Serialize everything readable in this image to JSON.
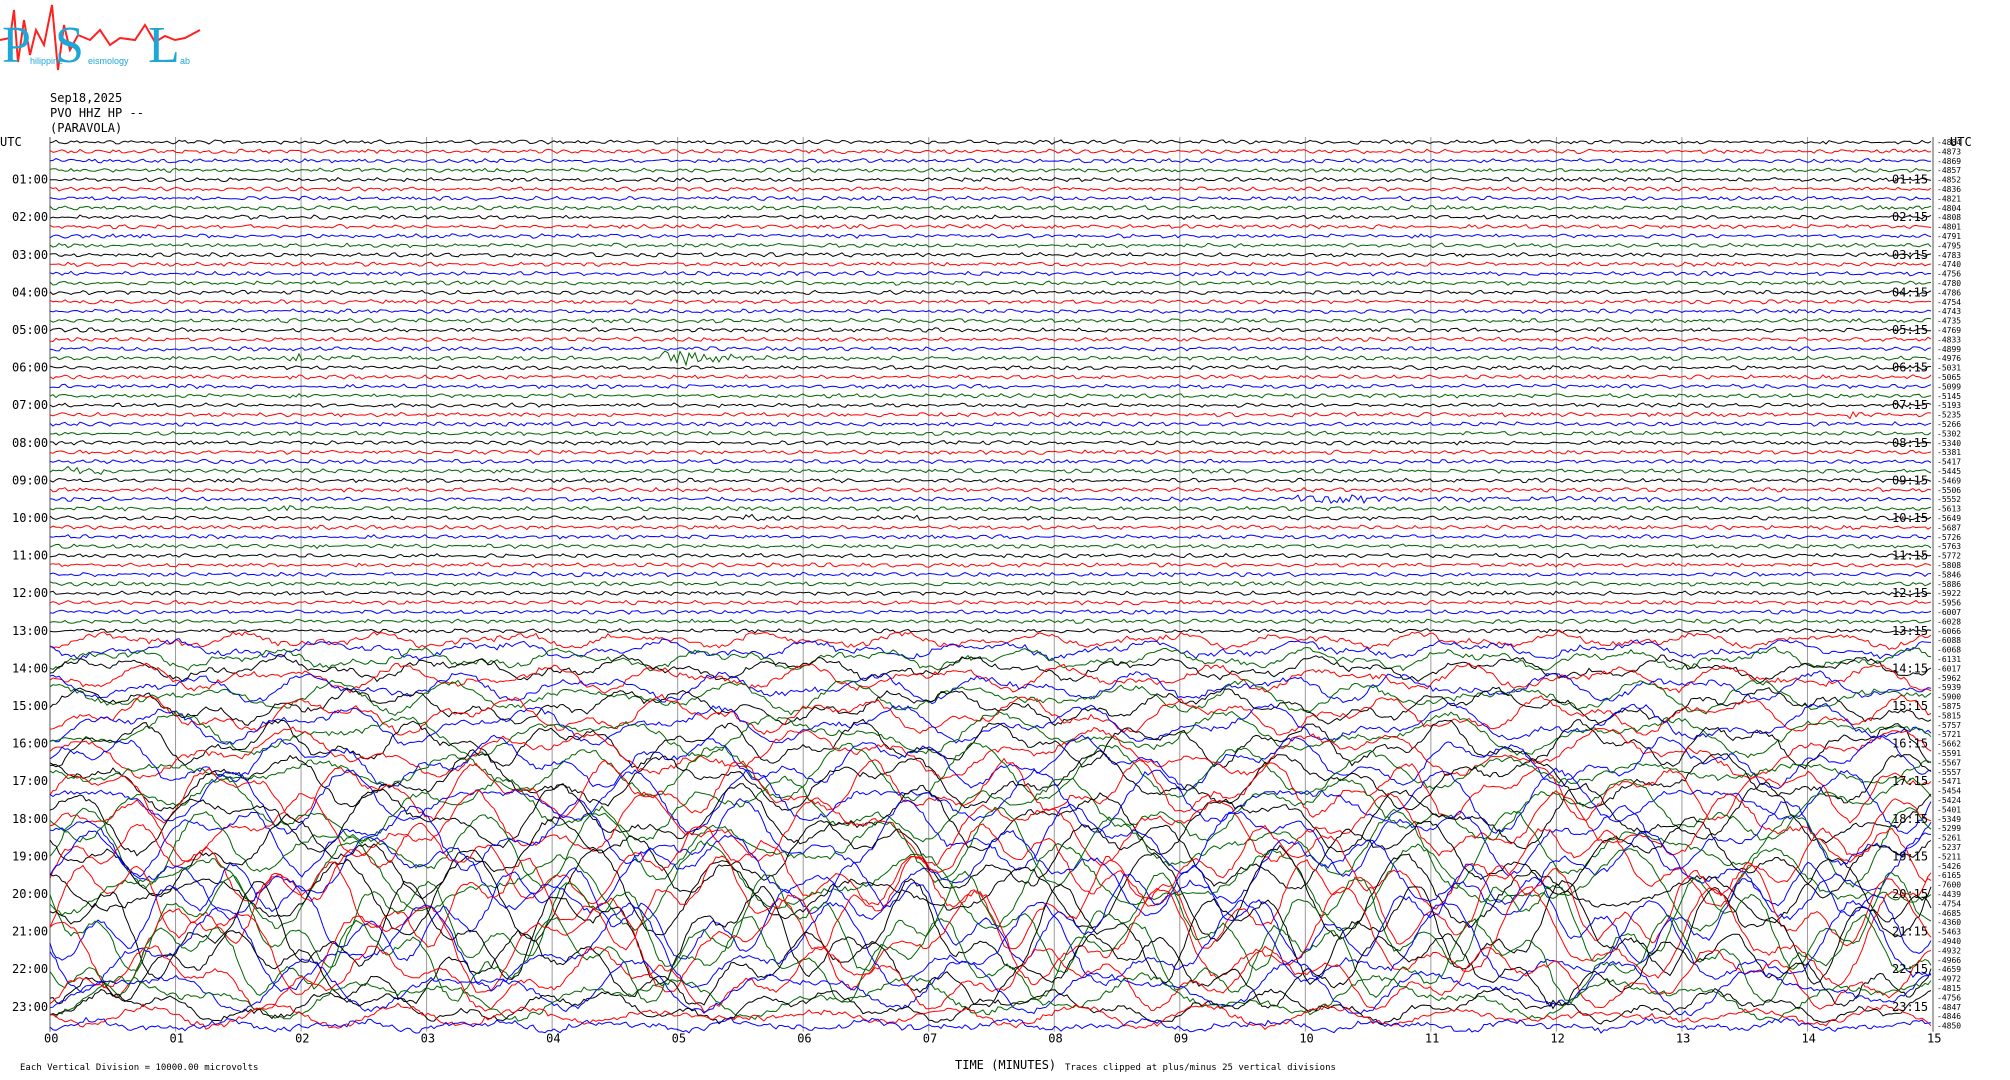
{
  "logo": {
    "letters": [
      "P",
      "S",
      "L"
    ],
    "words": [
      "hilippine",
      "eismology",
      "ab"
    ],
    "colors": {
      "letters": "#1ea7d6",
      "spikes": "#ff2020"
    }
  },
  "header": {
    "date": "Sep18,2025",
    "station": "PVO HHZ HP --",
    "location": "(PARAVOLA)"
  },
  "chart_data": {
    "type": "line",
    "title": "",
    "left_axis_label": "UTC",
    "right_axis_label": "UTC",
    "xlabel": "TIME (MINUTES)",
    "x_ticks": [
      "00",
      "01",
      "02",
      "03",
      "04",
      "05",
      "06",
      "07",
      "08",
      "09",
      "10",
      "11",
      "12",
      "13",
      "14",
      "15"
    ],
    "xlim": [
      0,
      15
    ],
    "left_hour_labels": [
      "01:00",
      "02:00",
      "03:00",
      "04:00",
      "05:00",
      "06:00",
      "07:00",
      "08:00",
      "09:00",
      "10:00",
      "11:00",
      "12:00",
      "13:00",
      "14:00",
      "15:00",
      "16:00",
      "17:00",
      "18:00",
      "19:00",
      "20:00",
      "21:00",
      "22:00",
      "23:00"
    ],
    "right_hour_labels": [
      "01:15",
      "02:15",
      "03:15",
      "04:15",
      "05:15",
      "06:15",
      "07:15",
      "08:15",
      "09:15",
      "10:15",
      "11:15",
      "12:15",
      "13:15",
      "14:15",
      "15:15",
      "16:15",
      "17:15",
      "18:15",
      "19:15",
      "20:15",
      "21:15",
      "22:15",
      "23:15"
    ],
    "trace_colors": [
      "#000000",
      "#ff0000",
      "#0000ff",
      "#006400"
    ],
    "trace_offsets": [
      "-4884",
      "-4873",
      "-4869",
      "-4857",
      "-4852",
      "-4836",
      "-4821",
      "-4804",
      "-4808",
      "-4801",
      "-4791",
      "-4795",
      "-4783",
      "-4740",
      "-4756",
      "-4780",
      "-4786",
      "-4754",
      "-4743",
      "-4735",
      "-4769",
      "-4833",
      "-4899",
      "-4976",
      "-5031",
      "-5065",
      "-5099",
      "-5145",
      "-5193",
      "-5235",
      "-5266",
      "-5302",
      "-5340",
      "-5381",
      "-5417",
      "-5445",
      "-5469",
      "-5506",
      "-5552",
      "-5613",
      "-5649",
      "-5687",
      "-5726",
      "-5763",
      "-5772",
      "-5808",
      "-5846",
      "-5886",
      "-5922",
      "-5956",
      "-6007",
      "-6028",
      "-6066",
      "-6088",
      "-6068",
      "-6131",
      "-6017",
      "-5962",
      "-5939",
      "-5900",
      "-5875",
      "-5815",
      "-5757",
      "-5721",
      "-5662",
      "-5591",
      "-5567",
      "-5557",
      "-5471",
      "-5454",
      "-5424",
      "-5401",
      "-5349",
      "-5299",
      "-5261",
      "-5237",
      "-5211",
      "-5426",
      "-6165",
      "-7600",
      "-4439",
      "-4754",
      "-4685",
      "-4360",
      "-5463",
      "-4940",
      "-4932",
      "-4966",
      "-4659",
      "-4972",
      "-4815",
      "-4756",
      "-4847",
      "-4846",
      "-4850"
    ],
    "events": [
      {
        "trace": 23,
        "start_min": 1.85,
        "end_min": 3.1,
        "amp": 4
      },
      {
        "trace": 23,
        "start_min": 4.85,
        "end_min": 5.9,
        "amp": 14
      },
      {
        "trace": 35,
        "start_min": 0.1,
        "end_min": 0.9,
        "amp": 6
      },
      {
        "trace": 38,
        "start_min": 9.8,
        "end_min": 15.0,
        "amp": 5
      },
      {
        "trace": 39,
        "start_min": 1.8,
        "end_min": 2.6,
        "amp": 6
      },
      {
        "trace": 40,
        "start_min": 5.5,
        "end_min": 5.9,
        "amp": 5
      },
      {
        "trace": 40,
        "start_min": 6.75,
        "end_min": 7.3,
        "amp": 3
      },
      {
        "trace": 29,
        "start_min": 14.3,
        "end_min": 14.9,
        "amp": 3
      },
      {
        "trace": 88,
        "start_min": 11.9,
        "end_min": 12.3,
        "amp": 8
      }
    ],
    "footer_left": "Each Vertical Division = 10000.00 microvolts",
    "footer_right": "Traces clipped at plus/minus 25 vertical divisions",
    "grid": true
  }
}
